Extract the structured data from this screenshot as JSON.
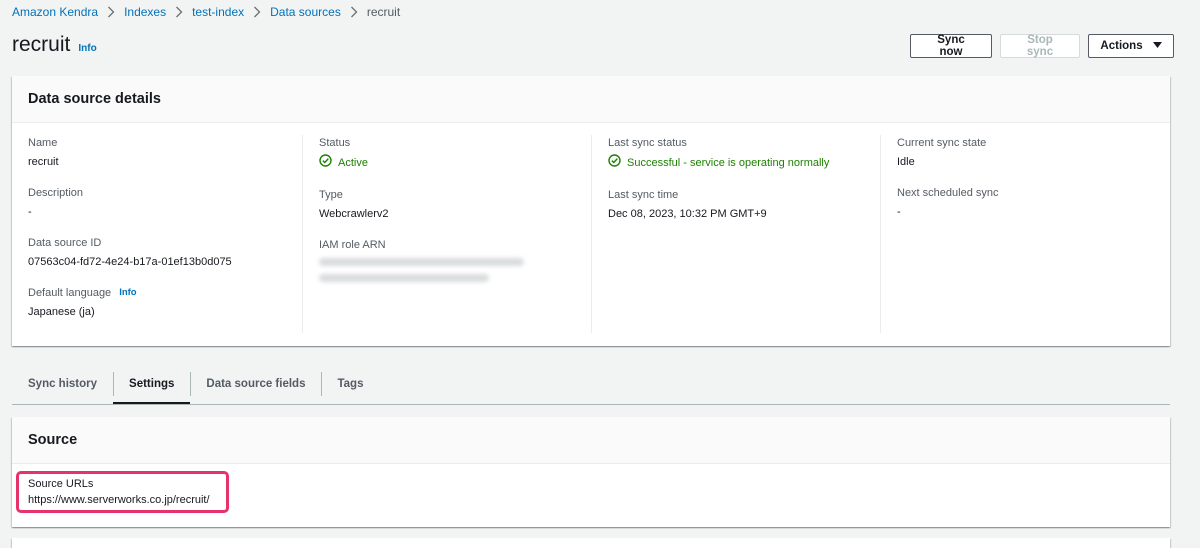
{
  "breadcrumb": {
    "items": [
      "Amazon Kendra",
      "Indexes",
      "test-index",
      "Data sources"
    ],
    "current": "recruit"
  },
  "page": {
    "title": "recruit",
    "info": "Info"
  },
  "buttons": {
    "sync_now": "Sync now",
    "stop_sync": "Stop sync",
    "actions": "Actions"
  },
  "details": {
    "title": "Data source details",
    "name_label": "Name",
    "name_value": "recruit",
    "description_label": "Description",
    "description_value": "-",
    "id_label": "Data source ID",
    "id_value": "07563c04-fd72-4e24-b17a-01ef13b0d075",
    "language_label": "Default language",
    "language_info": "Info",
    "language_value": "Japanese (ja)",
    "status_label": "Status",
    "status_value": "Active",
    "type_label": "Type",
    "type_value": "Webcrawlerv2",
    "iam_label": "IAM role ARN",
    "last_sync_status_label": "Last sync status",
    "last_sync_status_value": "Successful - service is operating normally",
    "last_sync_time_label": "Last sync time",
    "last_sync_time_value": "Dec 08, 2023, 10:32 PM GMT+9",
    "current_state_label": "Current sync state",
    "current_state_value": "Idle",
    "next_sync_label": "Next scheduled sync",
    "next_sync_value": "-"
  },
  "tabs": [
    "Sync history",
    "Settings",
    "Data source fields",
    "Tags"
  ],
  "active_tab": "Settings",
  "source": {
    "title": "Source",
    "urls_label": "Source URLs",
    "urls_value": "https://www.serverworks.co.jp/recruit/"
  },
  "colors": {
    "link": "#0073bb",
    "success": "#1d8102",
    "highlight": "#e7336b"
  }
}
